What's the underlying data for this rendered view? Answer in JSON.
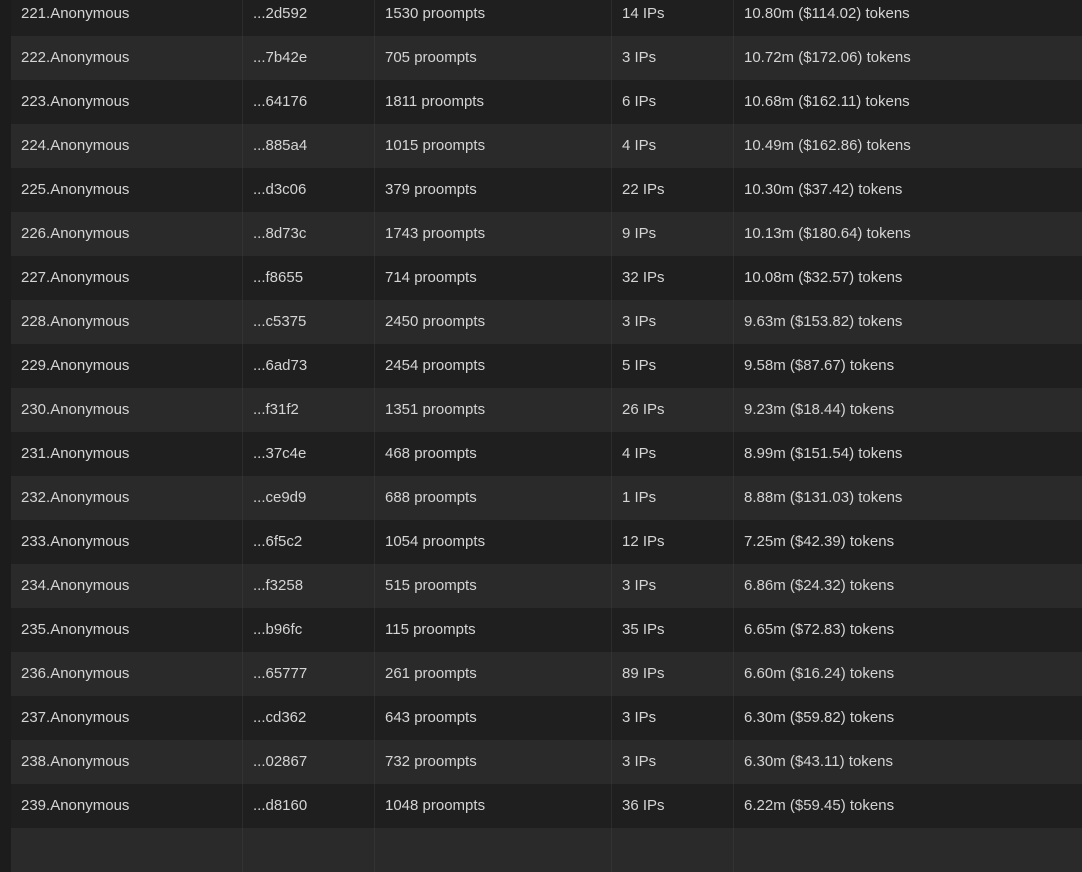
{
  "rows": [
    {
      "name": "221.Anonymous",
      "hash": "...2d592",
      "prompts": "1530 proompts",
      "ips": "14 IPs",
      "tokens": "10.80m ($114.02) tokens"
    },
    {
      "name": "222.Anonymous",
      "hash": "...7b42e",
      "prompts": "705 proompts",
      "ips": "3 IPs",
      "tokens": "10.72m ($172.06) tokens"
    },
    {
      "name": "223.Anonymous",
      "hash": "...64176",
      "prompts": "1811 proompts",
      "ips": "6 IPs",
      "tokens": "10.68m ($162.11) tokens"
    },
    {
      "name": "224.Anonymous",
      "hash": "...885a4",
      "prompts": "1015 proompts",
      "ips": "4 IPs",
      "tokens": "10.49m ($162.86) tokens"
    },
    {
      "name": "225.Anonymous",
      "hash": "...d3c06",
      "prompts": "379 proompts",
      "ips": "22 IPs",
      "tokens": "10.30m ($37.42) tokens"
    },
    {
      "name": "226.Anonymous",
      "hash": "...8d73c",
      "prompts": "1743 proompts",
      "ips": "9 IPs",
      "tokens": "10.13m ($180.64) tokens"
    },
    {
      "name": "227.Anonymous",
      "hash": "...f8655",
      "prompts": "714 proompts",
      "ips": "32 IPs",
      "tokens": "10.08m ($32.57) tokens"
    },
    {
      "name": "228.Anonymous",
      "hash": "...c5375",
      "prompts": "2450 proompts",
      "ips": "3 IPs",
      "tokens": "9.63m ($153.82) tokens"
    },
    {
      "name": "229.Anonymous",
      "hash": "...6ad73",
      "prompts": "2454 proompts",
      "ips": "5 IPs",
      "tokens": "9.58m ($87.67) tokens"
    },
    {
      "name": "230.Anonymous",
      "hash": "...f31f2",
      "prompts": "1351 proompts",
      "ips": "26 IPs",
      "tokens": "9.23m ($18.44) tokens"
    },
    {
      "name": "231.Anonymous",
      "hash": "...37c4e",
      "prompts": "468 proompts",
      "ips": "4 IPs",
      "tokens": "8.99m ($151.54) tokens"
    },
    {
      "name": "232.Anonymous",
      "hash": "...ce9d9",
      "prompts": "688 proompts",
      "ips": "1 IPs",
      "tokens": "8.88m ($131.03) tokens"
    },
    {
      "name": "233.Anonymous",
      "hash": "...6f5c2",
      "prompts": "1054 proompts",
      "ips": "12 IPs",
      "tokens": "7.25m ($42.39) tokens"
    },
    {
      "name": "234.Anonymous",
      "hash": "...f3258",
      "prompts": "515 proompts",
      "ips": "3 IPs",
      "tokens": "6.86m ($24.32) tokens"
    },
    {
      "name": "235.Anonymous",
      "hash": "...b96fc",
      "prompts": "115 proompts",
      "ips": "35 IPs",
      "tokens": "6.65m ($72.83) tokens"
    },
    {
      "name": "236.Anonymous",
      "hash": "...65777",
      "prompts": "261 proompts",
      "ips": "89 IPs",
      "tokens": "6.60m ($16.24) tokens"
    },
    {
      "name": "237.Anonymous",
      "hash": "...cd362",
      "prompts": "643 proompts",
      "ips": "3 IPs",
      "tokens": "6.30m ($59.82) tokens"
    },
    {
      "name": "238.Anonymous",
      "hash": "...02867",
      "prompts": "732 proompts",
      "ips": "3 IPs",
      "tokens": "6.30m ($43.11) tokens"
    },
    {
      "name": "239.Anonymous",
      "hash": "...d8160",
      "prompts": "1048 proompts",
      "ips": "36 IPs",
      "tokens": "6.22m ($59.45) tokens"
    },
    {
      "name": "",
      "hash": "",
      "prompts": "",
      "ips": "",
      "tokens": ""
    }
  ]
}
